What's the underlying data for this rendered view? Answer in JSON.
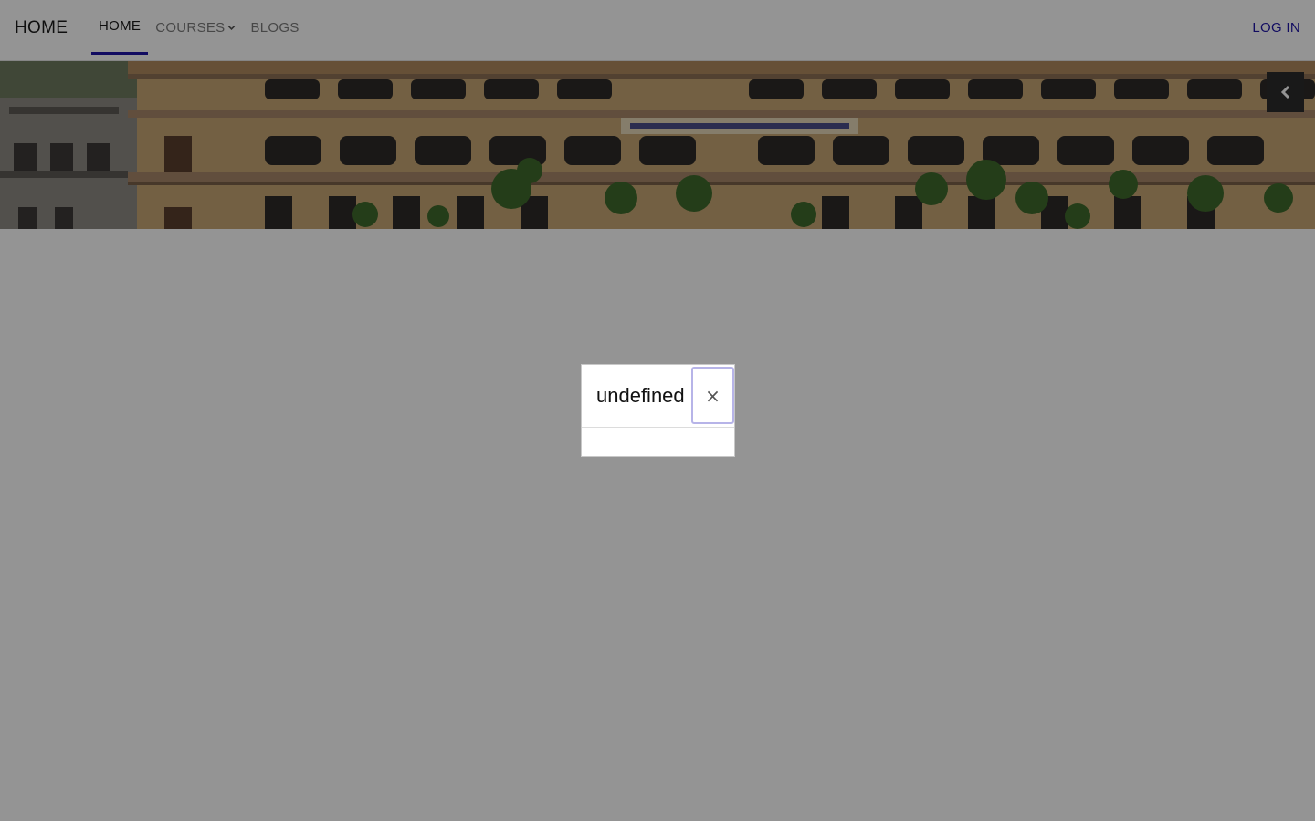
{
  "navbar": {
    "brand": "HOME",
    "items": [
      {
        "label": "HOME",
        "active": true
      },
      {
        "label": "COURSES",
        "has_dropdown": true
      },
      {
        "label": "BLOGS"
      }
    ],
    "login_label": "LOG IN",
    "accent_color": "#1f16a8"
  },
  "hero": {
    "image": "college building photo",
    "prev_icon": "chevron-left-icon"
  },
  "modal": {
    "title": "undefined",
    "close_label": "×"
  }
}
